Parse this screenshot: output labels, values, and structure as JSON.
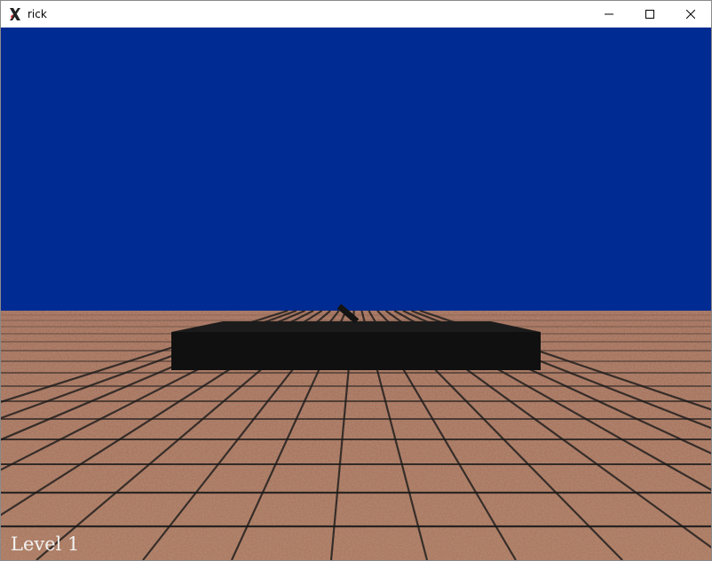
{
  "window": {
    "title": "rick",
    "icon": "x-app-icon",
    "controls": {
      "minimize_icon": "minimize-icon",
      "maximize_icon": "maximize-icon",
      "close_icon": "close-icon"
    }
  },
  "scene": {
    "sky_color": "#002b93",
    "floor_color": "#a46f58",
    "grid_line_color": "#1a1a1a",
    "object_color": "#111111",
    "object_top_color": "#1b1b1b"
  },
  "hud": {
    "level_label": "Level 1"
  }
}
